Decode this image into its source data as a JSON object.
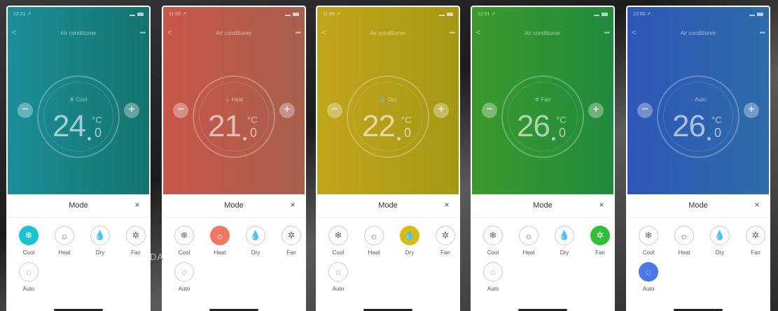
{
  "common": {
    "title": "Air conditioner",
    "temp_unit": "°C",
    "temp_decimal": "0",
    "minus": "−",
    "plus": "+",
    "back": "<",
    "more": "•••",
    "sheet_title": "Mode",
    "close": "×",
    "icons": {
      "Cool": "❄",
      "Heat": "☼",
      "Dry": "💧",
      "Fan": "✲",
      "Auto": "◌"
    }
  },
  "phones": [
    {
      "time": "12:21 ↗",
      "gradient": [
        "#1c8f9a",
        "#14746e"
      ],
      "mode": "Cool",
      "temp": "24",
      "active": "Cool",
      "active_color": "#1ac3cf",
      "modes": [
        "Cool",
        "Heat",
        "Dry",
        "Fan",
        "Auto"
      ]
    },
    {
      "time": "11:58 ↗",
      "gradient": [
        "#c9564a",
        "#a8604c"
      ],
      "mode": "Heat",
      "temp": "21",
      "active": "Heat",
      "active_color": "#f07860",
      "modes": [
        "Cool",
        "Heat",
        "Dry",
        "Fan",
        "Auto"
      ]
    },
    {
      "time": "11:59 ↗",
      "gradient": [
        "#c2a51c",
        "#a59814"
      ],
      "mode": "Dry",
      "temp": "22",
      "active": "Dry",
      "active_color": "#d9bb0e",
      "modes": [
        "Cool",
        "Heat",
        "Dry",
        "Fan",
        "Auto"
      ]
    },
    {
      "time": "12:01 ↗",
      "gradient": [
        "#3b9a2c",
        "#218a3e"
      ],
      "mode": "Fan",
      "temp": "26",
      "active": "Fan",
      "active_color": "#2fbf3a",
      "modes": [
        "Cool",
        "Heat",
        "Dry",
        "Fan",
        "Auto"
      ]
    },
    {
      "time": "12:00 ↗",
      "gradient": [
        "#2f56b8",
        "#2d6ca8"
      ],
      "mode": "Auto",
      "temp": "26",
      "active": "Auto",
      "active_color": "#4a79e6",
      "modes": [
        "Cool",
        "Heat",
        "Dry",
        "Fan",
        "Auto"
      ]
    }
  ],
  "overlay": "DA"
}
